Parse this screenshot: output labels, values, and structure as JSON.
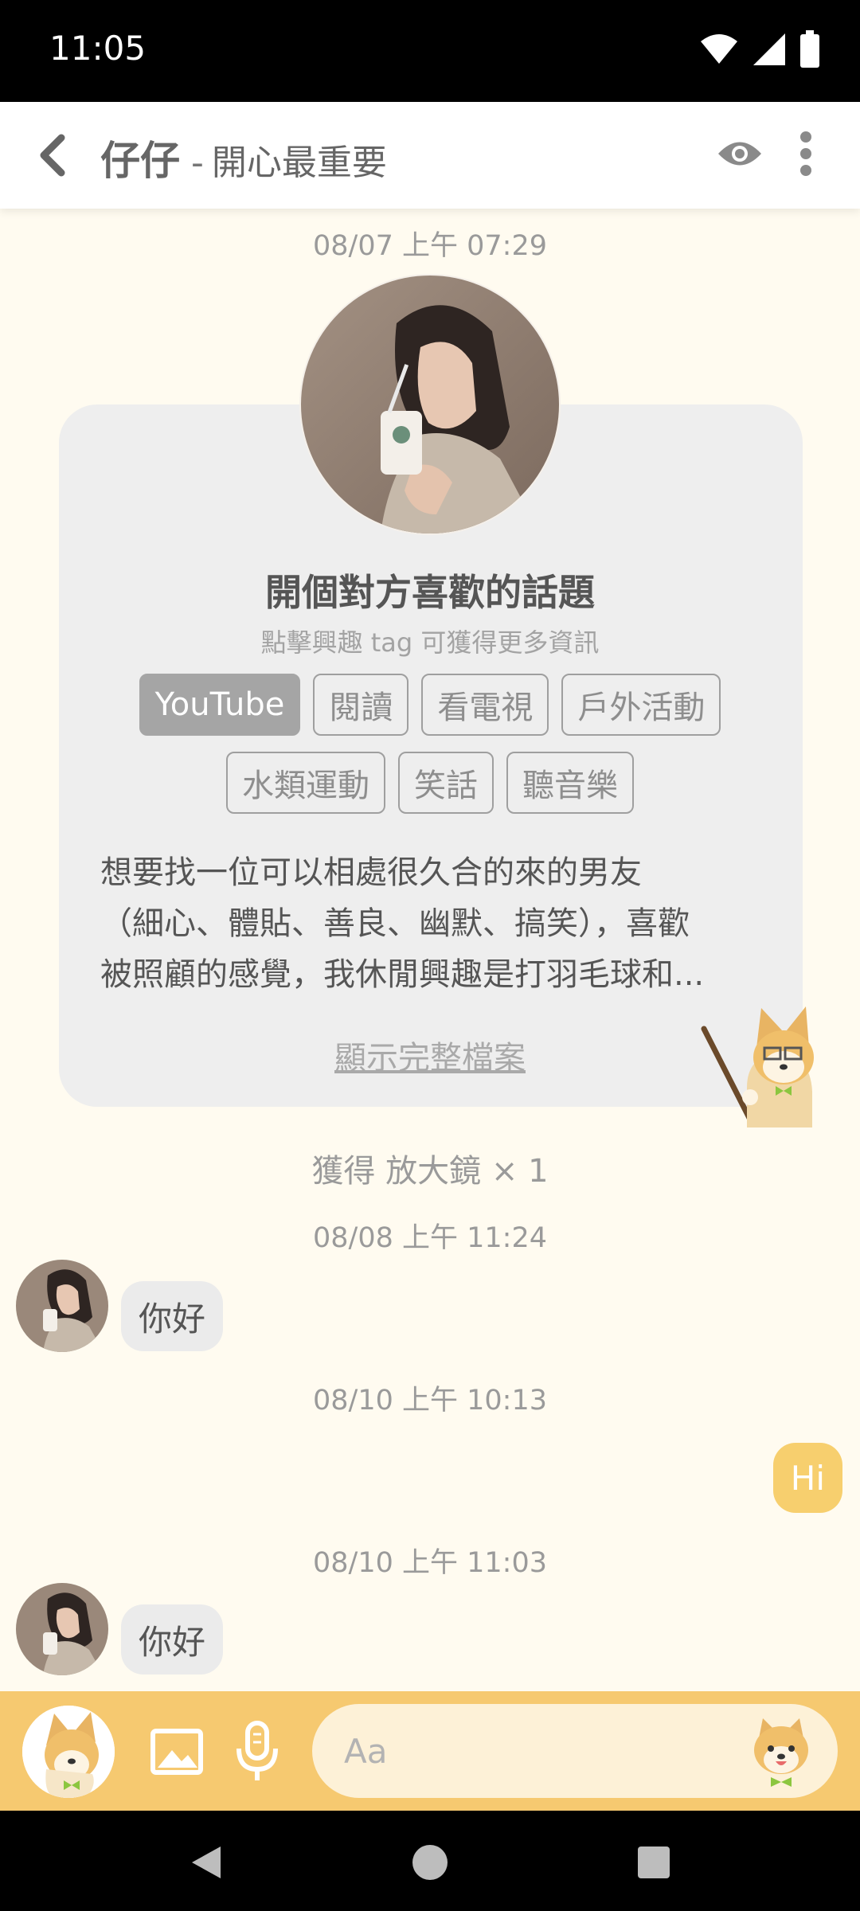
{
  "status_bar": {
    "time": "11:05"
  },
  "header": {
    "name": "仔仔",
    "separator": "-",
    "status_message": "開心最重要"
  },
  "timestamps": {
    "t1": "08/07 上午 07:29",
    "t2": "08/08 上午 11:24",
    "t3": "08/10 上午 10:13",
    "t4": "08/10 上午 11:03"
  },
  "profile_card": {
    "title": "開個對方喜歡的話題",
    "subtitle": "點擊興趣 tag 可獲得更多資訊",
    "tags": [
      "YouTube",
      "閱讀",
      "看電視",
      "戶外活動",
      "水類運動",
      "笑話",
      "聽音樂"
    ],
    "active_tag": "YouTube",
    "bio_lines": [
      "想要找一位可以相處很久合的來的男友",
      "（細心、體貼、善良、幽默、搞笑），喜歡",
      "被照顧的感覺，我休閒興趣是打羽毛球和..."
    ],
    "show_full_profile": "顯示完整檔案"
  },
  "reward_text": "獲得 放大鏡 × 1",
  "messages": [
    {
      "direction": "incoming",
      "text": "你好"
    },
    {
      "direction": "outgoing",
      "text": "Hi"
    },
    {
      "direction": "incoming",
      "text": "你好"
    }
  ],
  "input": {
    "placeholder": "Aa"
  },
  "colors": {
    "accent": "#f6c970",
    "outgoing_bubble": "#f7cf6e",
    "incoming_bubble": "#ebebeb",
    "background": "#fffbf0"
  },
  "icons": [
    "back-arrow-icon",
    "eye-icon",
    "more-vert-icon",
    "image-icon",
    "mic-icon",
    "shiba-sticker-icon",
    "wifi-icon",
    "signal-icon",
    "battery-icon"
  ]
}
